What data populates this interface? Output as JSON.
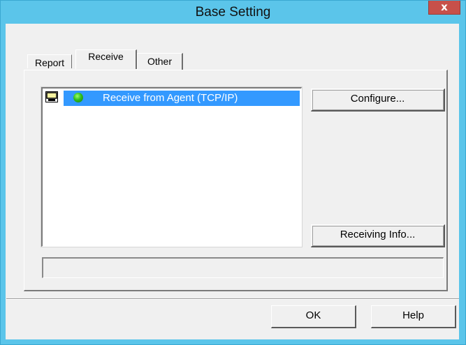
{
  "window": {
    "title": "Base Setting",
    "close_label": "x"
  },
  "tabs": [
    {
      "label": "Report"
    },
    {
      "label": "Receive"
    },
    {
      "label": "Other"
    }
  ],
  "list": {
    "items": [
      {
        "label": "Receive from Agent (TCP/IP)",
        "icon": "green-globe-icon",
        "selected": true
      }
    ]
  },
  "buttons": {
    "configure": "Configure...",
    "receiving_info": "Receiving Info...",
    "ok": "OK",
    "help": "Help"
  },
  "status_text": "",
  "colors": {
    "titlebar": "#5bc5ea",
    "close": "#c7504a",
    "selection": "#3399ff",
    "dialog": "#f0f0f0"
  }
}
